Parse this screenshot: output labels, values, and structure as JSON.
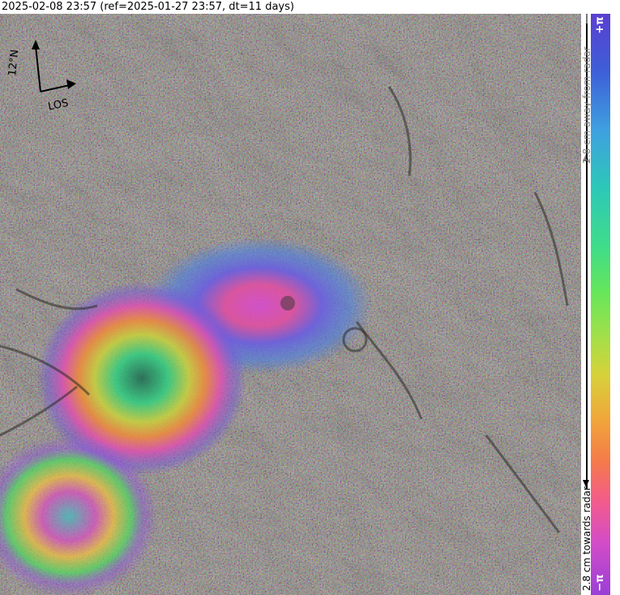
{
  "header": {
    "title": "2025-02-08 23:57 (ref=2025-01-27 23:57, dt=11 days)"
  },
  "compass": {
    "north_label": "12°N",
    "los_label": "LOS"
  },
  "colorbar": {
    "top_tick": "+π",
    "bottom_tick": "−π",
    "top_caption": "2.8 cm away from radar",
    "bottom_caption": "2.8 cm towards radar",
    "colors": [
      "#5a3fd0",
      "#3fa0e0",
      "#2cc8b8",
      "#66e65a",
      "#d6d23a",
      "#f1a53a",
      "#f35b8c",
      "#d34cc8",
      "#9a3fd6"
    ]
  }
}
